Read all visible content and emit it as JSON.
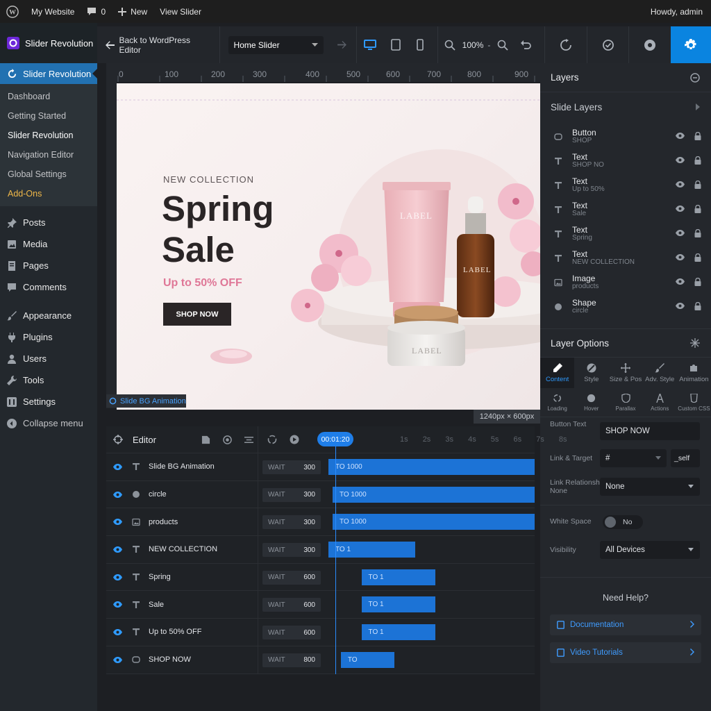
{
  "adminbar": {
    "site": "My Website",
    "comments": "0",
    "new": "New",
    "view": "View Slider",
    "howdy": "Howdy, admin"
  },
  "sidebar": {
    "brand": "Slider Revolution",
    "active": "Slider Revolution",
    "submenu": [
      "Dashboard",
      "Getting Started",
      "Slider Revolution",
      "Navigation Editor",
      "Global Settings",
      "Add-Ons"
    ],
    "menu": [
      "Posts",
      "Media",
      "Pages",
      "Comments",
      "Appearance",
      "Plugins",
      "Users",
      "Tools",
      "Settings",
      "Collapse menu"
    ]
  },
  "toolbar": {
    "back": "Back to WordPress Editor",
    "slider": "Home Slider",
    "zoom": "100%"
  },
  "ruler": {
    "ticks": [
      "0",
      "100",
      "200",
      "300",
      "400",
      "500",
      "600",
      "700",
      "800",
      "900"
    ]
  },
  "canvas": {
    "eyebrow": "NEW COLLECTION",
    "headline1": "Spring",
    "headline2": "Sale",
    "offer": "Up to 50% OFF",
    "cta": "SHOP NOW",
    "tube_label": "LABEL",
    "bottle_label": "LABEL",
    "jar_label": "LABEL",
    "size": "1240px × 600px",
    "bg_anim": "Slide BG Animation"
  },
  "layers": {
    "title": "Layers",
    "slide_layers": "Slide Layers",
    "items": [
      {
        "name": "Button",
        "sub": "SHOP",
        "icon": "button-icon"
      },
      {
        "name": "Text",
        "sub": "SHOP NO",
        "icon": "text-icon"
      },
      {
        "name": "Text",
        "sub": "Up to 50%",
        "icon": "text-icon"
      },
      {
        "name": "Text",
        "sub": "Sale",
        "icon": "text-icon"
      },
      {
        "name": "Text",
        "sub": "Spring",
        "icon": "text-icon"
      },
      {
        "name": "Text",
        "sub": "NEW COLLECTION",
        "icon": "text-icon"
      },
      {
        "name": "Image",
        "sub": "products",
        "icon": "image-icon"
      },
      {
        "name": "Shape",
        "sub": "circle",
        "icon": "shape-icon"
      }
    ]
  },
  "options": {
    "title": "Layer Options",
    "tabs": [
      "Content",
      "Style",
      "Size & Pos",
      "Adv. Style",
      "Animation"
    ],
    "subtabs": [
      "Loading",
      "Hover",
      "Parallax",
      "Actions",
      "Custom CSS"
    ],
    "button_text_label": "Button Text",
    "button_text": "SHOP NOW",
    "link_label": "Link & Target",
    "link_value": "#",
    "target_value": "_self",
    "rel_label": "Link Relationship",
    "rel_sub": "None",
    "rel_value": "None",
    "whitespace_label": "White Space",
    "whitespace_value": "No",
    "visibility_label": "Visibility",
    "visibility_value": "All Devices"
  },
  "help": {
    "title": "Need Help?",
    "docs": "Documentation",
    "videos": "Video Tutorials"
  },
  "timeline": {
    "editor": "Editor",
    "time": "00:01:20",
    "seconds": [
      "1s",
      "2s",
      "3s",
      "4s",
      "5s",
      "6s",
      "7s",
      "8s"
    ],
    "wait_label": "WAIT",
    "rows": [
      {
        "name": "Slide BG Animation",
        "icon": "text-icon",
        "wait": "300",
        "to": "TO 1000",
        "start": 0.0,
        "end": 1.0
      },
      {
        "name": "circle",
        "icon": "shape-icon",
        "wait": "300",
        "to": "TO 1000",
        "start": 0.02,
        "end": 1.0
      },
      {
        "name": "products",
        "icon": "image-icon",
        "wait": "300",
        "to": "TO 1000",
        "start": 0.02,
        "end": 1.0
      },
      {
        "name": "NEW COLLECTION",
        "icon": "text-icon",
        "wait": "300",
        "to": "TO 1",
        "start": 0.0,
        "end": 0.42
      },
      {
        "name": "Spring",
        "icon": "text-icon",
        "wait": "600",
        "to": "TO 1",
        "start": 0.16,
        "end": 0.52
      },
      {
        "name": "Sale",
        "icon": "text-icon",
        "wait": "600",
        "to": "TO 1",
        "start": 0.16,
        "end": 0.52
      },
      {
        "name": "Up to 50% OFF",
        "icon": "text-icon",
        "wait": "600",
        "to": "TO 1",
        "start": 0.16,
        "end": 0.52
      },
      {
        "name": "SHOP NOW",
        "icon": "button-icon",
        "wait": "800",
        "to": "TO",
        "start": 0.06,
        "end": 0.32
      }
    ]
  }
}
